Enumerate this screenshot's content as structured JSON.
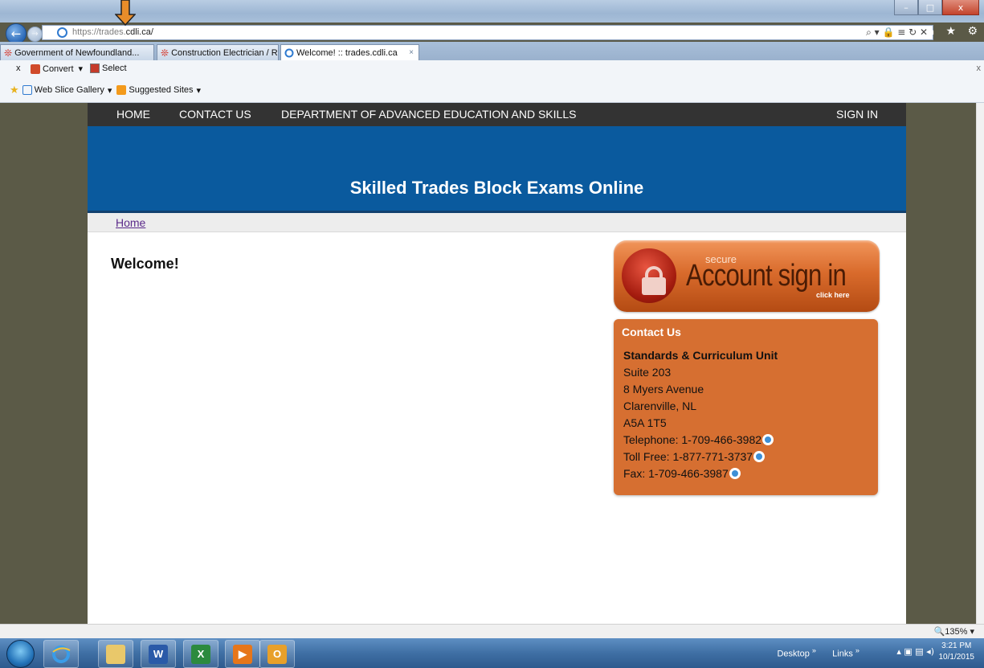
{
  "browser": {
    "url_host_dim": "https://trades.",
    "url_host_rest": "cdli.ca/",
    "address_icons": "⌕ ▾ 🔒 ≡ ↻ ✕",
    "nav_icons": "⌂ ★ ⚙",
    "window_buttons": {
      "minimize": "–",
      "maximize": "□",
      "close": "x"
    },
    "tabs": [
      {
        "label": "Government of Newfoundland..."
      },
      {
        "label": "Construction Electrician / Red ..."
      },
      {
        "label": "Welcome! :: trades.cdli.ca",
        "close": "×"
      }
    ],
    "commandbar": {
      "close_x": "x",
      "convert_label": "Convert",
      "convert_caret": "▾",
      "select_label": "Select",
      "web_slice_label": "Web Slice Gallery",
      "web_slice_caret": "▾",
      "suggested_label": "Suggested Sites",
      "suggested_caret": "▾",
      "right_close": "x"
    },
    "zoom": "🔍135%  ▾"
  },
  "site": {
    "nav": {
      "home": "HOME",
      "contact": "CONTACT US",
      "department": "DEPARTMENT OF ADVANCED EDUCATION AND SKILLS",
      "signin": "SIGN IN"
    },
    "title": "Skilled Trades Block Exams Online",
    "breadcrumb": "Home",
    "welcome": "Welcome!",
    "signin_button": {
      "secure": "secure",
      "main": "Account sign in",
      "click": "click here"
    },
    "contact": {
      "title": "Contact Us",
      "unit": "Standards & Curriculum Unit",
      "suite": "Suite 203",
      "street": "8 Myers Avenue",
      "city": "Clarenville, NL",
      "postal": "A5A 1T5",
      "telephone": "Telephone: 1-709-466-3982",
      "tollfree": "Toll Free: 1-877-771-3737",
      "fax": "Fax: 1-709-466-3987"
    }
  },
  "taskbar": {
    "word_letter": "W",
    "excel_letter": "X",
    "media_glyph": "▶",
    "outlook_letter": "O",
    "desktop_label": "Desktop",
    "links_label": "Links",
    "chevrons": "»",
    "tray_icons": "▴  ▣  ▤  ◂)",
    "time": "3:21 PM",
    "date": "10/1/2015"
  },
  "colors": {
    "nav_bg": "#333333",
    "banner_blue": "#0a5a9e",
    "contact_orange": "#d66f31",
    "signin_orange": "#d96b2c"
  }
}
